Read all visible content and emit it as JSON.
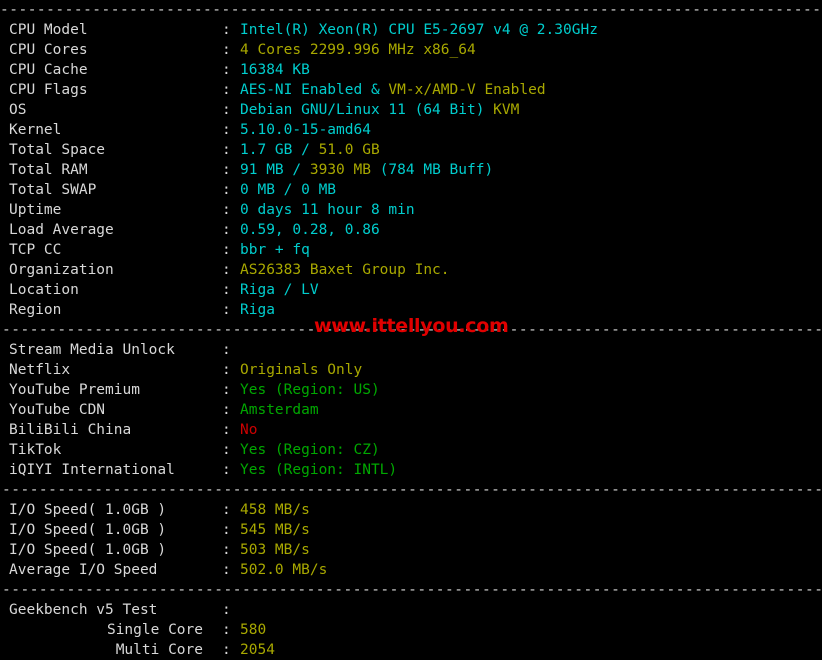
{
  "terminal": {
    "separator_char": "-",
    "colon": ":",
    "colors": {
      "background": "#000000",
      "label": "#d8d8d8",
      "cyan": "#00cdcd",
      "yellow": "#a8a800",
      "green": "#00a800",
      "red": "#cd0000",
      "watermark": "#e00000"
    },
    "rules": {
      "top": "----------------------------------------------------------------------------------------------------",
      "mid": "----------------------------------------------------------------------------------------------------"
    }
  },
  "watermark": {
    "text": "www.ittellyou.com"
  },
  "sections": [
    {
      "name": "system-info",
      "rows": [
        {
          "label": "CPU Model",
          "segments": [
            {
              "text": "Intel(R) Xeon(R) CPU E5-2697 v4 @ 2.30GHz",
              "color": "cyan"
            }
          ]
        },
        {
          "label": "CPU Cores",
          "segments": [
            {
              "text": "4 Cores 2299.996 MHz x86_64",
              "color": "yellow"
            }
          ]
        },
        {
          "label": "CPU Cache",
          "segments": [
            {
              "text": "16384 KB",
              "color": "cyan"
            }
          ]
        },
        {
          "label": "CPU Flags",
          "segments": [
            {
              "text": "AES-NI Enabled",
              "color": "cyan"
            },
            {
              "text": " & ",
              "color": "cyan"
            },
            {
              "text": "VM-x/AMD-V Enabled",
              "color": "yellow"
            }
          ]
        },
        {
          "label": "OS",
          "segments": [
            {
              "text": "Debian GNU/Linux 11 (64 Bit) ",
              "color": "cyan"
            },
            {
              "text": "KVM",
              "color": "yellow"
            }
          ]
        },
        {
          "label": "Kernel",
          "segments": [
            {
              "text": "5.10.0-15-amd64",
              "color": "cyan"
            }
          ]
        },
        {
          "label": "Total Space",
          "segments": [
            {
              "text": "1.7 GB ",
              "color": "cyan"
            },
            {
              "text": "/ ",
              "color": "cyan"
            },
            {
              "text": "51.0 GB",
              "color": "yellow"
            }
          ]
        },
        {
          "label": "Total RAM",
          "segments": [
            {
              "text": "91 MB ",
              "color": "cyan"
            },
            {
              "text": "/ ",
              "color": "cyan"
            },
            {
              "text": "3930 MB ",
              "color": "yellow"
            },
            {
              "text": "(784 MB Buff)",
              "color": "cyan"
            }
          ]
        },
        {
          "label": "Total SWAP",
          "segments": [
            {
              "text": "0 MB / 0 MB",
              "color": "cyan"
            }
          ]
        },
        {
          "label": "Uptime",
          "segments": [
            {
              "text": "0 days 11 hour 8 min",
              "color": "cyan"
            }
          ]
        },
        {
          "label": "Load Average",
          "segments": [
            {
              "text": "0.59, 0.28, 0.86",
              "color": "cyan"
            }
          ]
        },
        {
          "label": "TCP CC",
          "segments": [
            {
              "text": "bbr + fq",
              "color": "cyan"
            }
          ]
        },
        {
          "label": "Organization",
          "segments": [
            {
              "text": "AS26383 Baxet Group Inc.",
              "color": "yellow"
            }
          ]
        },
        {
          "label": "Location",
          "segments": [
            {
              "text": "Riga / LV",
              "color": "cyan"
            }
          ]
        },
        {
          "label": "Region",
          "segments": [
            {
              "text": "Riga",
              "color": "cyan"
            }
          ]
        }
      ]
    },
    {
      "name": "stream-media-unlock",
      "rows": [
        {
          "label": "Stream Media Unlock",
          "segments": []
        },
        {
          "label": "Netflix",
          "segments": [
            {
              "text": "Originals Only",
              "color": "yellow"
            }
          ]
        },
        {
          "label": "YouTube Premium",
          "segments": [
            {
              "text": "Yes (Region: US)",
              "color": "green"
            }
          ]
        },
        {
          "label": "YouTube CDN",
          "segments": [
            {
              "text": "Amsterdam",
              "color": "green"
            }
          ]
        },
        {
          "label": "BiliBili China",
          "segments": [
            {
              "text": "No",
              "color": "red"
            }
          ]
        },
        {
          "label": "TikTok",
          "segments": [
            {
              "text": "Yes (Region: CZ)",
              "color": "green"
            }
          ]
        },
        {
          "label": "iQIYI International",
          "segments": [
            {
              "text": "Yes (Region: INTL)",
              "color": "green"
            }
          ]
        }
      ]
    },
    {
      "name": "io-speed",
      "rows": [
        {
          "label": "I/O Speed( 1.0GB )",
          "segments": [
            {
              "text": "458 MB/s",
              "color": "yellow"
            }
          ]
        },
        {
          "label": "I/O Speed( 1.0GB )",
          "segments": [
            {
              "text": "545 MB/s",
              "color": "yellow"
            }
          ]
        },
        {
          "label": "I/O Speed( 1.0GB )",
          "segments": [
            {
              "text": "503 MB/s",
              "color": "yellow"
            }
          ]
        },
        {
          "label": "Average I/O Speed",
          "segments": [
            {
              "text": "502.0 MB/s",
              "color": "yellow"
            }
          ]
        }
      ]
    },
    {
      "name": "geekbench",
      "rows": [
        {
          "label": "Geekbench v5 Test",
          "segments": []
        },
        {
          "label": "Single Core",
          "indent": true,
          "segments": [
            {
              "text": "580",
              "color": "yellow"
            }
          ]
        },
        {
          "label": "Multi Core",
          "indent": true,
          "segments": [
            {
              "text": "2054",
              "color": "yellow"
            }
          ]
        }
      ]
    }
  ],
  "benchmark_values": {
    "io_speed_1": "458 MB/s",
    "io_speed_2": "545 MB/s",
    "io_speed_3": "503 MB/s",
    "io_speed_avg": "502.0 MB/s",
    "geekbench_single_core": "580",
    "geekbench_multi_core": "2054"
  }
}
